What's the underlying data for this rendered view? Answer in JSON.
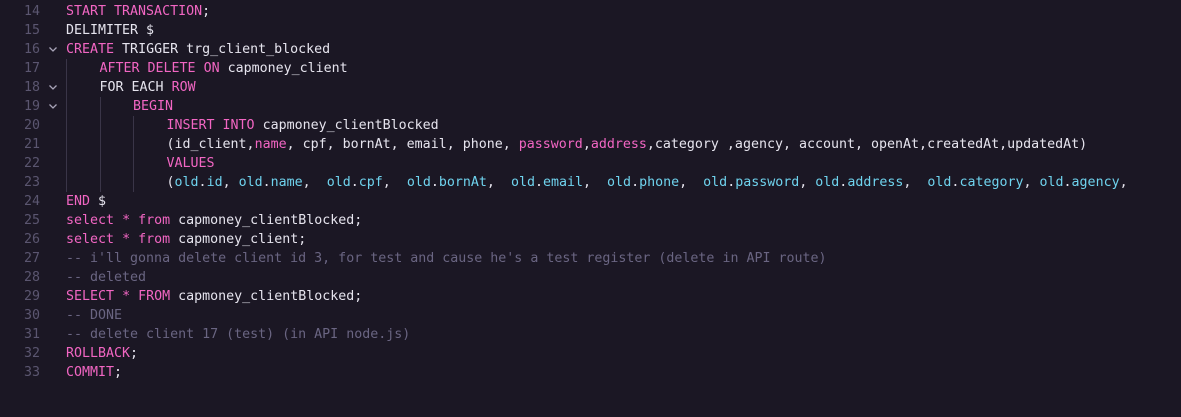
{
  "editor": {
    "lines": [
      {
        "n": "14",
        "fold": "",
        "indent": 0,
        "tokens": [
          [
            "kw",
            "START TRANSACTION"
          ],
          [
            "id",
            ";"
          ]
        ]
      },
      {
        "n": "15",
        "fold": "",
        "indent": 0,
        "tokens": [
          [
            "id",
            "DELIMITER $"
          ]
        ]
      },
      {
        "n": "16",
        "fold": "chevron",
        "indent": 0,
        "tokens": [
          [
            "kw",
            "CREATE"
          ],
          [
            "id",
            " TRIGGER trg_client_blocked"
          ]
        ]
      },
      {
        "n": "17",
        "fold": "",
        "indent": 1,
        "tokens": [
          [
            "kw",
            "AFTER DELETE ON"
          ],
          [
            "id",
            " capmoney_client"
          ]
        ]
      },
      {
        "n": "18",
        "fold": "chevron",
        "indent": 1,
        "tokens": [
          [
            "id",
            "FOR EACH "
          ],
          [
            "kw",
            "ROW"
          ]
        ]
      },
      {
        "n": "19",
        "fold": "chevron",
        "indent": 2,
        "tokens": [
          [
            "kw",
            "BEGIN"
          ]
        ]
      },
      {
        "n": "20",
        "fold": "",
        "indent": 3,
        "tokens": [
          [
            "kw",
            "INSERT INTO"
          ],
          [
            "id",
            " capmoney_clientBlocked"
          ]
        ]
      },
      {
        "n": "21",
        "fold": "",
        "indent": 3,
        "tokens": [
          [
            "id",
            "(id_client,"
          ],
          [
            "pink",
            "name"
          ],
          [
            "id",
            ", cpf, bornAt, email, phone, "
          ],
          [
            "pink",
            "password"
          ],
          [
            "id",
            ","
          ],
          [
            "pink",
            "address"
          ],
          [
            "id",
            ",category ,agency, account, openAt,createdAt,updatedAt)"
          ]
        ]
      },
      {
        "n": "22",
        "fold": "",
        "indent": 3,
        "tokens": [
          [
            "kw",
            "VALUES"
          ]
        ]
      },
      {
        "n": "23",
        "fold": "",
        "indent": 3,
        "tokens": [
          [
            "id",
            "("
          ],
          [
            "col",
            "old"
          ],
          [
            "id",
            "."
          ],
          [
            "col",
            "id"
          ],
          [
            "id",
            ", "
          ],
          [
            "col",
            "old"
          ],
          [
            "id",
            "."
          ],
          [
            "col",
            "name"
          ],
          [
            "id",
            ",  "
          ],
          [
            "col",
            "old"
          ],
          [
            "id",
            "."
          ],
          [
            "col",
            "cpf"
          ],
          [
            "id",
            ",  "
          ],
          [
            "col",
            "old"
          ],
          [
            "id",
            "."
          ],
          [
            "col",
            "bornAt"
          ],
          [
            "id",
            ",  "
          ],
          [
            "col",
            "old"
          ],
          [
            "id",
            "."
          ],
          [
            "col",
            "email"
          ],
          [
            "id",
            ",  "
          ],
          [
            "col",
            "old"
          ],
          [
            "id",
            "."
          ],
          [
            "col",
            "phone"
          ],
          [
            "id",
            ",  "
          ],
          [
            "col",
            "old"
          ],
          [
            "id",
            "."
          ],
          [
            "col",
            "password"
          ],
          [
            "id",
            ", "
          ],
          [
            "col",
            "old"
          ],
          [
            "id",
            "."
          ],
          [
            "col",
            "address"
          ],
          [
            "id",
            ",  "
          ],
          [
            "col",
            "old"
          ],
          [
            "id",
            "."
          ],
          [
            "col",
            "category"
          ],
          [
            "id",
            ", "
          ],
          [
            "col",
            "old"
          ],
          [
            "id",
            "."
          ],
          [
            "col",
            "agency"
          ],
          [
            "id",
            ","
          ]
        ]
      },
      {
        "n": "24",
        "fold": "",
        "indent": 0,
        "tokens": [
          [
            "kw",
            "END"
          ],
          [
            "id",
            " $"
          ]
        ]
      },
      {
        "n": "25",
        "fold": "",
        "indent": 0,
        "tokens": [
          [
            "kw",
            "select"
          ],
          [
            "id",
            " "
          ],
          [
            "op",
            "*"
          ],
          [
            "id",
            " "
          ],
          [
            "kw",
            "from"
          ],
          [
            "id",
            " capmoney_clientBlocked;"
          ]
        ]
      },
      {
        "n": "26",
        "fold": "",
        "indent": 0,
        "tokens": [
          [
            "kw",
            "select"
          ],
          [
            "id",
            " "
          ],
          [
            "op",
            "*"
          ],
          [
            "id",
            " "
          ],
          [
            "kw",
            "from"
          ],
          [
            "id",
            " capmoney_client;"
          ]
        ]
      },
      {
        "n": "27",
        "fold": "",
        "indent": 0,
        "tokens": [
          [
            "cm",
            "-- i'll gonna delete client id 3, for test and cause he's a test register (delete in API route)"
          ]
        ]
      },
      {
        "n": "28",
        "fold": "",
        "indent": 0,
        "tokens": [
          [
            "cm",
            "-- deleted"
          ]
        ]
      },
      {
        "n": "29",
        "fold": "",
        "indent": 0,
        "tokens": [
          [
            "kw",
            "SELECT"
          ],
          [
            "id",
            " "
          ],
          [
            "op",
            "*"
          ],
          [
            "id",
            " "
          ],
          [
            "kw",
            "FROM"
          ],
          [
            "id",
            " capmoney_clientBlocked;"
          ]
        ]
      },
      {
        "n": "30",
        "fold": "",
        "indent": 0,
        "tokens": [
          [
            "cm",
            "-- DONE"
          ]
        ]
      },
      {
        "n": "31",
        "fold": "",
        "indent": 0,
        "tokens": [
          [
            "cm",
            "-- delete client 17 (test) (in API node.js)"
          ]
        ]
      },
      {
        "n": "32",
        "fold": "",
        "indent": 0,
        "tokens": [
          [
            "kw",
            "ROLLBACK"
          ],
          [
            "id",
            ";"
          ]
        ]
      },
      {
        "n": "33",
        "fold": "",
        "indent": 0,
        "tokens": [
          [
            "kw",
            "COMMIT"
          ],
          [
            "id",
            ";"
          ]
        ]
      }
    ]
  },
  "colors": {
    "background": "#1b1724",
    "keyword": "#f266c3",
    "identifier": "#e6e4ee",
    "column": "#6fd3ee",
    "comment": "#6a6582",
    "gutter": "#5b5670"
  },
  "icons": {
    "fold": "chevron-down-icon"
  }
}
